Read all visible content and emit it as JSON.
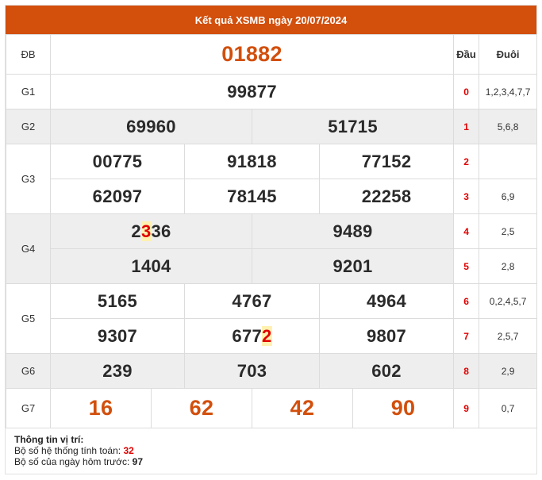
{
  "title": "Kết quả XSMB ngày 20/07/2024",
  "headers": {
    "dau": "Đầu",
    "duoi": "Đuôi"
  },
  "prizes": {
    "db": {
      "label": "ĐB",
      "value": "01882"
    },
    "g1": {
      "label": "G1",
      "values": [
        "99877"
      ]
    },
    "g2": {
      "label": "G2",
      "values": [
        "69960",
        "51715"
      ]
    },
    "g3": {
      "label": "G3",
      "values": [
        "00775",
        "91818",
        "77152",
        "62097",
        "78145",
        "22258"
      ]
    },
    "g4": {
      "label": "G4",
      "values": [
        "2336",
        "9489",
        "1404",
        "9201"
      ]
    },
    "g5": {
      "label": "G5",
      "values": [
        "5165",
        "4767",
        "4964",
        "9307",
        "6772",
        "9807"
      ]
    },
    "g6": {
      "label": "G6",
      "values": [
        "239",
        "703",
        "602"
      ]
    },
    "g7": {
      "label": "G7",
      "values": [
        "16",
        "62",
        "42",
        "90"
      ]
    }
  },
  "loto": [
    {
      "dau": "0",
      "duoi": "1,2,3,4,7,7"
    },
    {
      "dau": "1",
      "duoi": "5,6,8"
    },
    {
      "dau": "2",
      "duoi": ""
    },
    {
      "dau": "3",
      "duoi": "6,9"
    },
    {
      "dau": "4",
      "duoi": "2,5"
    },
    {
      "dau": "5",
      "duoi": "2,8"
    },
    {
      "dau": "6",
      "duoi": "0,2,4,5,7"
    },
    {
      "dau": "7",
      "duoi": "2,5,7"
    },
    {
      "dau": "8",
      "duoi": "2,9"
    },
    {
      "dau": "9",
      "duoi": "0,7"
    }
  ],
  "highlights": {
    "g4_0": {
      "before": "2",
      "digit": "3",
      "after": "36"
    },
    "g5_4": {
      "before": "677",
      "digit": "2",
      "after": ""
    }
  },
  "info": {
    "heading": "Thông tin vị trí:",
    "line1_label": "Bộ số hệ thống tính toán:",
    "line1_value": "32",
    "line2_label": "Bộ số của ngày hôm trước:",
    "line2_value": "97"
  },
  "colors": {
    "header_bg": "#d24f0c",
    "special_number": "#d24f0c",
    "dau_red": "#e00000",
    "row_gray": "#eeeeee"
  }
}
